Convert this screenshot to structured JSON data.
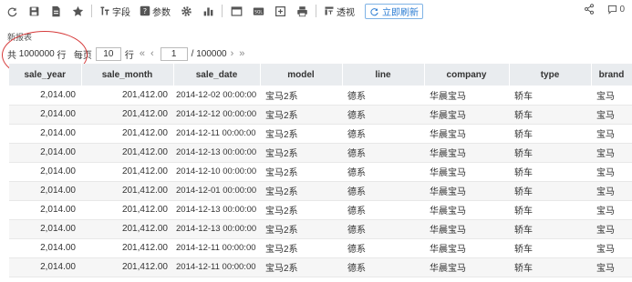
{
  "toolbar": {
    "field_label": "字段",
    "params_label": "参数",
    "pivot_label": "透视",
    "refresh_label": "立即刷新",
    "comment_count": "0"
  },
  "report": {
    "title": "新报表"
  },
  "pager": {
    "total_prefix": "共",
    "total_rows": "1000000",
    "total_suffix": "行",
    "per_page_prefix": "每页",
    "per_page": "10",
    "per_page_suffix": "行",
    "current_page": "1",
    "total_pages": "/ 100000"
  },
  "table": {
    "columns": [
      "sale_year",
      "sale_month",
      "sale_date",
      "model",
      "line",
      "company",
      "type",
      "brand"
    ],
    "rows": [
      [
        "2,014.00",
        "201,412.00",
        "2014-12-02 00:00:00",
        "宝马2系",
        "德系",
        "华晨宝马",
        "轿车",
        "宝马"
      ],
      [
        "2,014.00",
        "201,412.00",
        "2014-12-12 00:00:00",
        "宝马2系",
        "德系",
        "华晨宝马",
        "轿车",
        "宝马"
      ],
      [
        "2,014.00",
        "201,412.00",
        "2014-12-11 00:00:00",
        "宝马2系",
        "德系",
        "华晨宝马",
        "轿车",
        "宝马"
      ],
      [
        "2,014.00",
        "201,412.00",
        "2014-12-13 00:00:00",
        "宝马2系",
        "德系",
        "华晨宝马",
        "轿车",
        "宝马"
      ],
      [
        "2,014.00",
        "201,412.00",
        "2014-12-10 00:00:00",
        "宝马2系",
        "德系",
        "华晨宝马",
        "轿车",
        "宝马"
      ],
      [
        "2,014.00",
        "201,412.00",
        "2014-12-01 00:00:00",
        "宝马2系",
        "德系",
        "华晨宝马",
        "轿车",
        "宝马"
      ],
      [
        "2,014.00",
        "201,412.00",
        "2014-12-13 00:00:00",
        "宝马2系",
        "德系",
        "华晨宝马",
        "轿车",
        "宝马"
      ],
      [
        "2,014.00",
        "201,412.00",
        "2014-12-13 00:00:00",
        "宝马2系",
        "德系",
        "华晨宝马",
        "轿车",
        "宝马"
      ],
      [
        "2,014.00",
        "201,412.00",
        "2014-12-11 00:00:00",
        "宝马2系",
        "德系",
        "华晨宝马",
        "轿车",
        "宝马"
      ],
      [
        "2,014.00",
        "201,412.00",
        "2014-12-11 00:00:00",
        "宝马2系",
        "德系",
        "华晨宝马",
        "轿车",
        "宝马"
      ]
    ]
  },
  "colors": {
    "accent": "#2b7cd3",
    "header_bg": "#e9ecef",
    "alt_row_bg": "#f6f6f6",
    "highlight_circle": "#d63a3a"
  }
}
